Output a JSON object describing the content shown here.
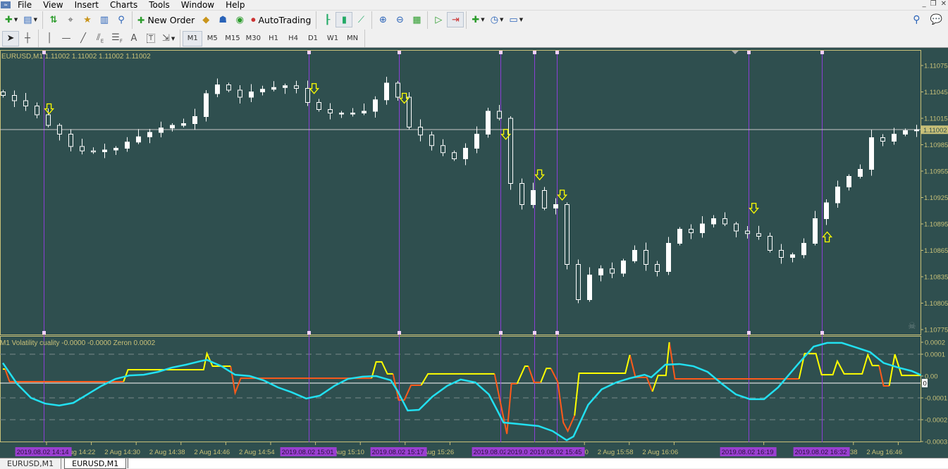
{
  "menu": {
    "items": [
      "File",
      "View",
      "Insert",
      "Charts",
      "Tools",
      "Window",
      "Help"
    ]
  },
  "window_controls": {
    "minimize": "_",
    "restore": "❐",
    "close": "✕"
  },
  "toolbar1": {
    "new_order_label": "New Order",
    "autotrading_label": "AutoTrading",
    "icons": [
      "new-chart-icon",
      "profiles-icon",
      "market-watch-icon",
      "data-window-icon",
      "navigator-icon",
      "terminal-icon",
      "strategy-tester-icon",
      "new-order-icon",
      "metaeditor-icon",
      "signals-icon",
      "community-icon",
      "autotrading-icon",
      "bar-chart-icon",
      "candlesticks-icon",
      "line-chart-icon",
      "zoom-in-icon",
      "zoom-out-icon",
      "tile-windows-icon",
      "chart-shift-icon",
      "autoscroll-icon",
      "indicators-icon",
      "periods-icon",
      "templates-icon",
      "search-icon",
      "chat-icon"
    ]
  },
  "toolbar2": {
    "tools": [
      "cursor",
      "crosshair",
      "vertical-line",
      "horizontal-line",
      "trendline",
      "equidistant-channel",
      "fibonacci-retracement",
      "text",
      "text-label",
      "arrows"
    ],
    "tool_glyphs": {
      "text": "A",
      "text_label": "T",
      "fibo_channel_sub": "E",
      "fibo_sub": "F"
    },
    "timeframes": [
      "M1",
      "M5",
      "M15",
      "M30",
      "H1",
      "H4",
      "D1",
      "W1",
      "MN"
    ],
    "active_timeframe": "M1"
  },
  "chart": {
    "header": "EURUSD,M1  1.11002 1.11002 1.11002 1.11002",
    "symbol": "EURUSD",
    "timeframe": "M1",
    "current_price": "1.11002",
    "price_axis_labels": [
      "1.11075",
      "1.11045",
      "1.11015",
      "1.10985",
      "1.10955",
      "1.10925",
      "1.10895",
      "1.10865",
      "1.10835",
      "1.10805",
      "1.10775"
    ],
    "colors": {
      "background": "#2f4f4f",
      "axis": "#c8c078",
      "candle": "#ffffff",
      "marker_line": "#8b3fd6",
      "arrow": "#ffff00",
      "label_box": "#9a3fd0"
    },
    "first_open": 1.11045,
    "closes": [
      1.11041,
      1.11035,
      1.11029,
      1.11019,
      1.11007,
      1.10997,
      1.10983,
      1.10978,
      1.10977,
      1.10979,
      1.10981,
      1.10988,
      1.10994,
      1.10999,
      1.11004,
      1.11007,
      1.11009,
      1.11017,
      1.11043,
      1.11053,
      1.11047,
      1.11039,
      1.11045,
      1.11048,
      1.1105,
      1.11052,
      1.11049,
      1.11033,
      1.11025,
      1.11021,
      1.11021,
      1.11021,
      1.11023,
      1.11036,
      1.11055,
      1.11039,
      1.11005,
      1.10996,
      1.10984,
      1.10976,
      1.10969,
      1.10981,
      1.10997,
      1.11023,
      1.11015,
      1.10941,
      1.10917,
      1.10933,
      1.10913,
      1.10917,
      1.10849,
      1.10809,
      1.10837,
      1.10844,
      1.10839,
      1.10853,
      1.10865,
      1.10849,
      1.10841,
      1.10873,
      1.10889,
      1.10885,
      1.10895,
      1.10901,
      1.10895,
      1.10887,
      1.10884,
      1.10881,
      1.10865,
      1.10857,
      1.1086,
      1.10873,
      1.10901,
      1.10919,
      1.10937,
      1.10949,
      1.10957,
      1.10993,
      1.10989,
      1.10997,
      1.11001,
      1.11002
    ],
    "arrows": [
      {
        "dir": "down",
        "bar": 4.1,
        "price": 1.11025
      },
      {
        "dir": "down",
        "bar": 27.6,
        "price": 1.11048
      },
      {
        "dir": "down",
        "bar": 35.6,
        "price": 1.11037
      },
      {
        "dir": "down",
        "bar": 44.6,
        "price": 1.10996
      },
      {
        "dir": "down",
        "bar": 47.6,
        "price": 1.1095
      },
      {
        "dir": "down",
        "bar": 49.6,
        "price": 1.10927
      },
      {
        "dir": "down",
        "bar": 66.6,
        "price": 1.10912
      },
      {
        "dir": "up",
        "bar": 73.1,
        "price": 1.10881
      }
    ],
    "markers": [
      {
        "bar": 3.6,
        "label": "2019.08.02 14:14"
      },
      {
        "bar": 27.1,
        "label": "2019.08.02 15:01"
      },
      {
        "bar": 35.1,
        "label": "2019.08.02 15:17"
      },
      {
        "bar": 44.1,
        "label": "2019.08.02"
      },
      {
        "bar": 47.1,
        "label": "2019.0"
      },
      {
        "bar": 49.1,
        "label": "2019.08.02 15:45"
      },
      {
        "bar": 66.1,
        "label": "2019.08.02 16:19"
      },
      {
        "bar": 72.6,
        "label": "2019.08.02 16:32"
      }
    ]
  },
  "indicator": {
    "header": "M1 Volatility cuality -0.0000 -0.0000  Zeron 0.0002",
    "axis_labels": [
      "0.0002",
      "0.0001",
      "0.00",
      "-0.0001",
      "-0.0002",
      "-0.0003"
    ],
    "level_label": "0",
    "colors": {
      "rising": "#ffff00",
      "falling": "#ff5a1a",
      "smooth": "#22e0f0",
      "level": "#ffffff"
    },
    "rising_segments": [
      [
        [
          0,
          3.2e-05
        ],
        [
          0.2,
          3.2e-05
        ]
      ],
      [
        [
          10.7,
          -2.6e-05
        ],
        [
          11.1,
          2.9e-05
        ],
        [
          17.8,
          2.9e-05
        ],
        [
          18.1,
          0.000103
        ],
        [
          18.6,
          4.5e-05
        ],
        [
          20.2,
          4.5e-05
        ]
      ],
      [
        [
          32.7,
          -1e-05
        ],
        [
          33.1,
          6.5e-05
        ],
        [
          33.6,
          6.5e-05
        ],
        [
          34.1,
          1e-05
        ],
        [
          34.6,
          1e-05
        ]
      ],
      [
        [
          37.1,
          -4.2e-05
        ],
        [
          37.7,
          1e-05
        ],
        [
          43.6,
          1e-05
        ]
      ],
      [
        [
          45.6,
          -3.5e-05
        ],
        [
          46.3,
          4.5e-05
        ],
        [
          46.6,
          4.5e-05
        ]
      ],
      [
        [
          47.7,
          -2.9e-05
        ],
        [
          48.2,
          3.5e-05
        ],
        [
          48.6,
          3.5e-05
        ]
      ],
      [
        [
          50.7,
          -0.000181
        ],
        [
          51.1,
          1.3e-05
        ],
        [
          55.2,
          1.3e-05
        ],
        [
          55.6,
          9.7e-05
        ]
      ],
      [
        [
          57.6,
          -7.1e-05
        ],
        [
          58.1,
          3e-06
        ],
        [
          58.8,
          3e-06
        ],
        [
          59.1,
          0.000155
        ]
      ],
      [
        [
          70.6,
          -1.3e-05
        ],
        [
          71.1,
          0.000103
        ],
        [
          72.1,
          0.000103
        ],
        [
          72.6,
          6e-06
        ],
        [
          73.6,
          6e-06
        ],
        [
          74,
          6.8e-05
        ],
        [
          74.6,
          1e-05
        ],
        [
          76.2,
          1e-05
        ],
        [
          76.7,
          9.7e-05
        ],
        [
          77.1,
          4.8e-05
        ],
        [
          77.7,
          4.8e-05
        ]
      ],
      [
        [
          78.6,
          -4.5e-05
        ],
        [
          79.1,
          0.0001
        ],
        [
          79.7,
          3e-06
        ],
        [
          81.7,
          3e-06
        ]
      ]
    ],
    "falling_segments": [
      [
        [
          0.2,
          3.2e-05
        ],
        [
          0.6,
          -2.6e-05
        ],
        [
          10.7,
          -2.6e-05
        ]
      ],
      [
        [
          20.2,
          4.5e-05
        ],
        [
          20.6,
          -7.7e-05
        ],
        [
          21.1,
          -1e-05
        ],
        [
          32.7,
          -1e-05
        ]
      ],
      [
        [
          34.6,
          1e-05
        ],
        [
          35.1,
          -0.00011
        ],
        [
          35.6,
          -0.00011
        ],
        [
          36.2,
          -4.2e-05
        ],
        [
          37.1,
          -4.2e-05
        ]
      ],
      [
        [
          43.6,
          1e-05
        ],
        [
          44.7,
          -0.000265
        ],
        [
          45.1,
          -3.5e-05
        ],
        [
          45.6,
          -3.5e-05
        ]
      ],
      [
        [
          46.6,
          4.5e-05
        ],
        [
          47.1,
          -2.9e-05
        ],
        [
          47.7,
          -2.9e-05
        ]
      ],
      [
        [
          48.6,
          3.5e-05
        ],
        [
          49.2,
          -2.6e-05
        ],
        [
          49.7,
          -0.000213
        ],
        [
          50.1,
          -0.000252
        ],
        [
          50.7,
          -0.000181
        ]
      ],
      [
        [
          55.6,
          9.7e-05
        ],
        [
          56.1,
          -6e-06
        ],
        [
          57.1,
          -6e-06
        ],
        [
          57.6,
          -7.1e-05
        ]
      ],
      [
        [
          59.1,
          0.000155
        ],
        [
          59.6,
          -1.3e-05
        ],
        [
          70.6,
          -1.3e-05
        ]
      ],
      [
        [
          77.7,
          4.8e-05
        ],
        [
          78.1,
          -4.5e-05
        ],
        [
          78.6,
          -4.5e-05
        ]
      ]
    ],
    "smooth_line": [
      [
        0,
        6e-05
      ],
      [
        1.25,
        -3.5e-05
      ],
      [
        2.5,
        -0.0001
      ],
      [
        3.75,
        -0.000126
      ],
      [
        5,
        -0.000135
      ],
      [
        6.25,
        -0.000123
      ],
      [
        7.5,
        -8.4e-05
      ],
      [
        8.75,
        -4.5e-05
      ],
      [
        10,
        -1.3e-05
      ],
      [
        11.25,
        3e-06
      ],
      [
        12.5,
        6e-06
      ],
      [
        13.75,
        1.9e-05
      ],
      [
        15,
        3.9e-05
      ],
      [
        16.25,
        5.2e-05
      ],
      [
        17.5,
        6.8e-05
      ],
      [
        18.1,
        7.4e-05
      ],
      [
        19.4,
        4.5e-05
      ],
      [
        20.6,
        6e-06
      ],
      [
        21.9,
        0
      ],
      [
        23.1,
        -1.9e-05
      ],
      [
        24.4,
        -5.2e-05
      ],
      [
        25.6,
        -7.4e-05
      ],
      [
        26.9,
        -0.000103
      ],
      [
        28.1,
        -9e-05
      ],
      [
        29.4,
        -4.5e-05
      ],
      [
        30.6,
        -1.3e-05
      ],
      [
        31.9,
        -3e-06
      ],
      [
        33.1,
        0
      ],
      [
        34.4,
        -1.9e-05
      ],
      [
        35,
        -6.8e-05
      ],
      [
        35.9,
        -0.000158
      ],
      [
        36.9,
        -0.000155
      ],
      [
        38.1,
        -9.4e-05
      ],
      [
        39.4,
        -4.5e-05
      ],
      [
        40.6,
        -1.6e-05
      ],
      [
        41.9,
        -2.9e-05
      ],
      [
        43.1,
        -8.4e-05
      ],
      [
        43.75,
        -0.000148
      ],
      [
        44.4,
        -0.000213
      ],
      [
        45.6,
        -0.000219
      ],
      [
        47.5,
        -0.000229
      ],
      [
        48.75,
        -0.000252
      ],
      [
        50,
        -0.000294
      ],
      [
        50.6,
        -0.000277
      ],
      [
        51.9,
        -0.000132
      ],
      [
        53.1,
        -6.1e-05
      ],
      [
        54.4,
        -2.9e-05
      ],
      [
        55.6,
        -1e-05
      ],
      [
        56.9,
        6e-06
      ],
      [
        57.5,
        -6e-06
      ],
      [
        58.75,
        5.2e-05
      ],
      [
        60,
        5.5e-05
      ],
      [
        61.25,
        4.5e-05
      ],
      [
        62.5,
        1.9e-05
      ],
      [
        63.75,
        -3.5e-05
      ],
      [
        65,
        -8.4e-05
      ],
      [
        66.25,
        -0.000106
      ],
      [
        67.5,
        -0.000106
      ],
      [
        68.75,
        -5.2e-05
      ],
      [
        70.6,
        6e-05
      ],
      [
        71.9,
        0.000135
      ],
      [
        73.1,
        0.000152
      ],
      [
        74.4,
        0.000152
      ],
      [
        75.6,
        0.000132
      ],
      [
        76.9,
        0.00011
      ],
      [
        78.1,
        6e-05
      ],
      [
        79.4,
        3.9e-05
      ],
      [
        80.6,
        2.3e-05
      ],
      [
        81.6,
        0
      ]
    ]
  },
  "time_axis": {
    "labels": [
      "2 Aug 14:14",
      "2 Aug 14:22",
      "2 Aug 14:30",
      "2 Aug 14:38",
      "2 Aug 14:46",
      "2 Aug 14:54",
      "2 Aug 15:02",
      "2 Aug 15:10",
      "2 Aug 15:18",
      "2 Aug 15:26",
      "",
      "",
      "2 Aug 15:50",
      "2 Aug 15:58",
      "2 Aug 16:06",
      "",
      "2 Aug 16:22",
      "",
      "2 Aug 16:38",
      "2 Aug 16:46"
    ]
  },
  "tabs": [
    {
      "label": "EURUSD,M1",
      "active": false
    },
    {
      "label": "EURUSD,M1",
      "active": true
    }
  ]
}
